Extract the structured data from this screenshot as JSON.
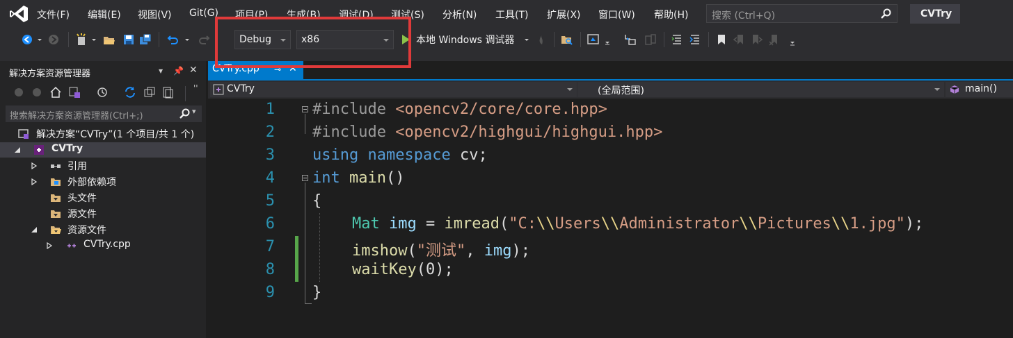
{
  "menubar": {
    "items": [
      "文件(F)",
      "编辑(E)",
      "视图(V)",
      "Git(G)",
      "项目(P)",
      "生成(B)",
      "调试(D)",
      "测试(S)",
      "分析(N)",
      "工具(T)",
      "扩展(X)",
      "窗口(W)",
      "帮助(H)"
    ],
    "search_placeholder": "搜索 (Ctrl+Q)",
    "solution_title": "CVTry"
  },
  "toolbar": {
    "config_value": "Debug",
    "platform_value": "x86",
    "run_label": "本地 Windows 调试器"
  },
  "solution_explorer": {
    "title": "解决方案资源管理器",
    "search_placeholder": "搜索解决方案资源管理器(Ctrl+;)",
    "tree": [
      {
        "label": "解决方案“CVTry”(1 个项目/共 1 个)",
        "icon": "solution-icon"
      },
      {
        "label": "CVTry",
        "icon": "cpp-project-icon",
        "bold": true
      },
      {
        "label": "引用",
        "icon": "references-icon"
      },
      {
        "label": "外部依赖项",
        "icon": "external-deps-icon"
      },
      {
        "label": "头文件",
        "icon": "filter-icon"
      },
      {
        "label": "源文件",
        "icon": "filter-icon"
      },
      {
        "label": "资源文件",
        "icon": "filter-open-icon"
      },
      {
        "label": "CVTry.cpp",
        "icon": "cpp-file-icon"
      }
    ]
  },
  "editor": {
    "tab_label": "CVTry.cpp",
    "nav_project": "CVTry",
    "nav_scope": "(全局范围)",
    "nav_member": "main()",
    "line_numbers": [
      "1",
      "2",
      "3",
      "4",
      "5",
      "6",
      "7",
      "8",
      "9"
    ],
    "code": {
      "l1_directive": "#include",
      "l1_path": "<opencv2/core/core.hpp>",
      "l2_directive": "#include",
      "l2_path": "<opencv2/highgui/highgui.hpp>",
      "l3_using": "using",
      "l3_namespace": "namespace",
      "l3_name": "cv;",
      "l4_type": "int",
      "l4_fn": "main",
      "l4_parens": "()",
      "l5_brace": "{",
      "l6_type": "Mat",
      "l6_var": "img",
      "l6_assign": " = ",
      "l6_fn": "imread",
      "l6_open": "(",
      "l6_str_1": "\"C:",
      "l6_esc_1": "\\\\",
      "l6_str_2": "Users",
      "l6_esc_2": "\\\\",
      "l6_str_3": "Administrator",
      "l6_esc_3": "\\\\",
      "l6_str_4": "Pictures",
      "l6_esc_4": "\\\\",
      "l6_str_5": "1.jpg\"",
      "l6_close": ");",
      "l7_fn": "imshow",
      "l7_open": "(",
      "l7_str": "\"测试\"",
      "l7_comma": ", ",
      "l7_var": "img",
      "l7_close": ");",
      "l8_fn": "waitKey",
      "l8_open": "(",
      "l8_num": "0",
      "l8_close": ");",
      "l9_brace": "}"
    }
  },
  "colors": {
    "accent": "#007acc",
    "highlight_box": "#e03a3a",
    "change_bar": "#57a64a",
    "keyword": "#569cd6",
    "type": "#4ec9b0",
    "string": "#d69d85"
  }
}
